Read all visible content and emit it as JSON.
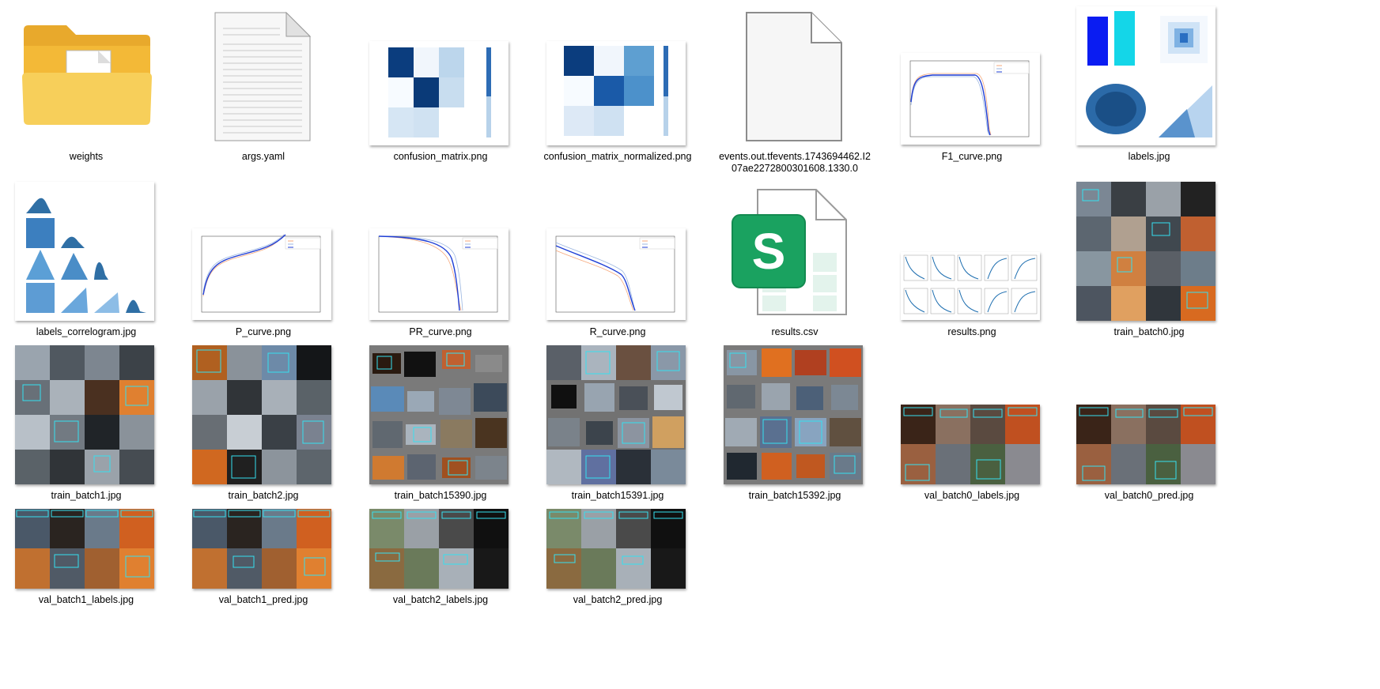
{
  "files": [
    {
      "name": "weights",
      "type": "folder",
      "icon": "folder-icon"
    },
    {
      "name": "args.yaml",
      "type": "text",
      "icon": "text-document-icon"
    },
    {
      "name": "confusion_matrix.png",
      "type": "image",
      "icon": "confusion-matrix-thumbnail"
    },
    {
      "name": "confusion_matrix_normalized.png",
      "type": "image",
      "icon": "confusion-matrix-normalized-thumbnail"
    },
    {
      "name": "events.out.tfevents.1743694462.I207ae2272800301608.1330.0",
      "type": "generic",
      "icon": "blank-file-icon"
    },
    {
      "name": "F1_curve.png",
      "type": "image",
      "icon": "f1-curve-thumbnail"
    },
    {
      "name": "labels.jpg",
      "type": "image",
      "icon": "labels-thumbnail"
    },
    {
      "name": "labels_correlogram.jpg",
      "type": "image",
      "icon": "correlogram-thumbnail"
    },
    {
      "name": "P_curve.png",
      "type": "image",
      "icon": "p-curve-thumbnail"
    },
    {
      "name": "PR_curve.png",
      "type": "image",
      "icon": "pr-curve-thumbnail"
    },
    {
      "name": "R_curve.png",
      "type": "image",
      "icon": "r-curve-thumbnail"
    },
    {
      "name": "results.csv",
      "type": "spreadsheet",
      "icon": "spreadsheet-icon"
    },
    {
      "name": "results.png",
      "type": "image",
      "icon": "results-thumbnail"
    },
    {
      "name": "train_batch0.jpg",
      "type": "image",
      "icon": "batch-mosaic-thumbnail"
    },
    {
      "name": "train_batch1.jpg",
      "type": "image",
      "icon": "batch-mosaic-thumbnail"
    },
    {
      "name": "train_batch2.jpg",
      "type": "image",
      "icon": "batch-mosaic-thumbnail"
    },
    {
      "name": "train_batch15390.jpg",
      "type": "image",
      "icon": "batch-mosaic-thumbnail"
    },
    {
      "name": "train_batch15391.jpg",
      "type": "image",
      "icon": "batch-mosaic-thumbnail"
    },
    {
      "name": "train_batch15392.jpg",
      "type": "image",
      "icon": "batch-mosaic-thumbnail"
    },
    {
      "name": "val_batch0_labels.jpg",
      "type": "image",
      "icon": "batch-mosaic-thumbnail"
    },
    {
      "name": "val_batch0_pred.jpg",
      "type": "image",
      "icon": "batch-mosaic-thumbnail"
    },
    {
      "name": "val_batch1_labels.jpg",
      "type": "image",
      "icon": "batch-mosaic-thumbnail"
    },
    {
      "name": "val_batch1_pred.jpg",
      "type": "image",
      "icon": "batch-mosaic-thumbnail"
    },
    {
      "name": "val_batch2_labels.jpg",
      "type": "image",
      "icon": "batch-mosaic-thumbnail"
    },
    {
      "name": "val_batch2_pred.jpg",
      "type": "image",
      "icon": "batch-mosaic-thumbnail"
    }
  ],
  "colors": {
    "folder": "#f5c542",
    "spreadsheet_green": "#1aa260",
    "plot_blue": "#1f3fd6"
  }
}
